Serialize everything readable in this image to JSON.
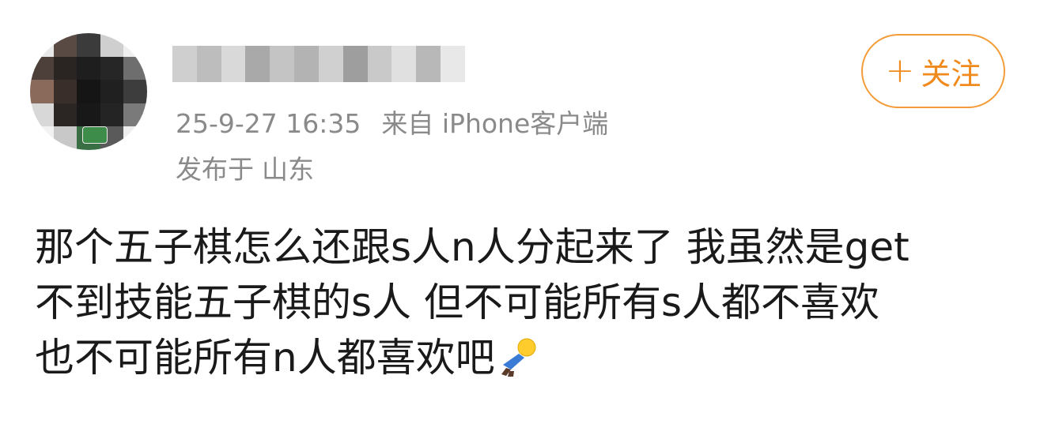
{
  "post": {
    "timestamp": "25-9-27 16:35",
    "source": "来自 iPhone客户端",
    "location_label": "发布于",
    "location_value": "山东",
    "follow_button": {
      "plus": "+",
      "label": "关注",
      "color": "#f08a1c"
    },
    "text_lines": [
      "那个五子棋怎么还跟s人n人分起来了 我虽然是get",
      "不到技能五子棋的s人 但不可能所有s人都不喜欢",
      "也不可能所有n人都喜欢吧"
    ],
    "emoji_icon": "lying-down-figure-icon"
  }
}
